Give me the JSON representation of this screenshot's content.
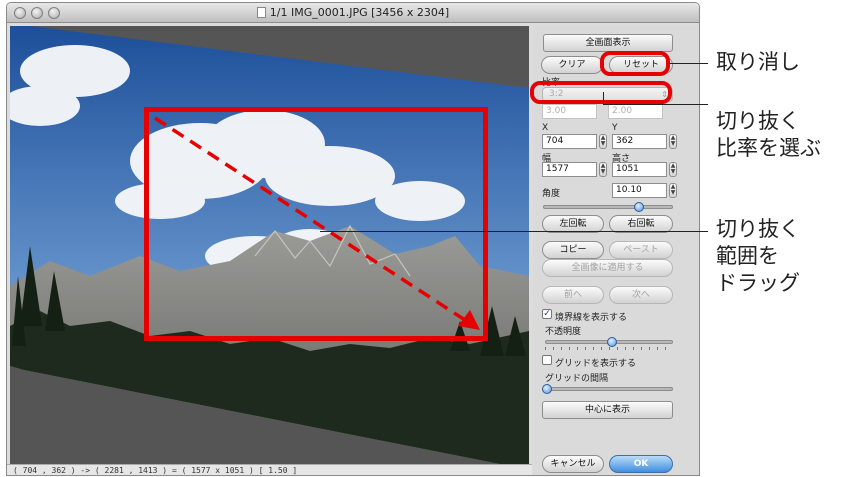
{
  "window": {
    "title": "1/1 IMG_0001.JPG [3456 x 2304]"
  },
  "status_bar": "( 704 , 362 ) -> ( 2281 , 1413 ) = ( 1577 x 1051 ) [ 1.50 ]",
  "panel": {
    "fullscreen_button": "全画面表示",
    "clear_button": "クリア",
    "reset_button": "リセット",
    "ratio_label": "比率",
    "ratio_select": "3:2",
    "ratio_w": "3.00",
    "ratio_h": "2.00",
    "x_label": "X",
    "y_label": "Y",
    "x_value": "704",
    "y_value": "362",
    "width_label": "幅",
    "height_label": "高さ",
    "width_value": "1577",
    "height_value": "1051",
    "angle_label": "角度",
    "angle_value": "10.10",
    "rotate_left_button": "左回転",
    "rotate_right_button": "右回転",
    "copy_button": "コピー",
    "paste_button": "ペースト",
    "apply_all_button": "全画像に適用する",
    "prev_button": "前へ",
    "next_button": "次へ",
    "show_border_label": "境界線を表示する",
    "show_border_checked": true,
    "opacity_label": "不透明度",
    "show_grid_label": "グリッドを表示する",
    "show_grid_checked": false,
    "grid_spacing_label": "グリッドの間隔",
    "center_button": "中心に表示",
    "cancel_button": "キャンセル",
    "ok_button": "OK"
  },
  "callouts": {
    "undo": "取り消し",
    "ratio": "切り抜く\n比率を選ぶ",
    "drag": "切り抜く\n範囲を\nドラッグ"
  },
  "colors": {
    "highlight": "#e60000",
    "ok_button": "#3f8fe0"
  }
}
